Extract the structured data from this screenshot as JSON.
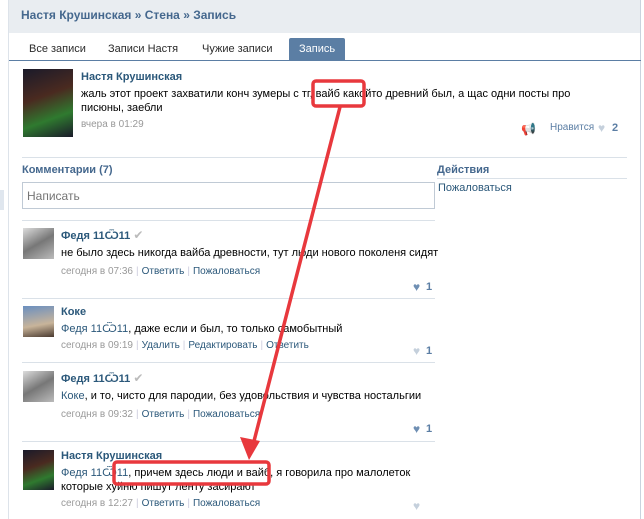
{
  "breadcrumb": "Настя Крушинская » Стена » Запись",
  "tabs": [
    "Все записи",
    "Записи Настя",
    "Чужие записи",
    "Запись"
  ],
  "post": {
    "author": "Настя Крушинская",
    "text": "жаль этот проект захватили конч зумеры с тг, вайб какойто древний был, а щас одни посты про писюны, заебли",
    "time": "вчера в 01:29",
    "like_label": "Нравится",
    "likes": "2"
  },
  "comments_header": "Комментарии (7)",
  "write_placeholder": "Написать",
  "actions": {
    "title": "Действия",
    "report": "Пожаловаться"
  },
  "comments": [
    {
      "author": "Федя 11Ѿ11",
      "mention": "",
      "text": "не было здесь никогда вайба древности, тут люди нового поколеня сидят",
      "time": "сегодня в 07:36",
      "links": [
        "Ответить",
        "Пожаловаться"
      ],
      "likes": "1"
    },
    {
      "author": "Коке",
      "mention": "Федя 11Ѿ11",
      "text": ", даже если и был, то только самобытный",
      "time": "сегодня в 09:19",
      "links": [
        "Удалить",
        "Редактировать",
        "Ответить"
      ],
      "likes": "1"
    },
    {
      "author": "Федя 11Ѿ11",
      "mention": "Коке",
      "text": ", и то, чисто для пародии, без удовольствия и чувства ностальгии",
      "time": "сегодня в 09:32",
      "links": [
        "Ответить",
        "Пожаловаться"
      ],
      "likes": "1"
    },
    {
      "author": "Настя Крушинская",
      "mention": "Федя 11Ѿ11",
      "text": ", причем здесь люди и вайб, я говорила про малолеток которые хуйню пишут ленту засирают",
      "time": "сегодня в 12:27",
      "links": [
        "Ответить",
        "Пожаловаться"
      ],
      "likes": ""
    }
  ],
  "colors": {
    "annotation": "#e8383d",
    "link": "#2b587a",
    "tab_active": "#5b7ea4"
  }
}
